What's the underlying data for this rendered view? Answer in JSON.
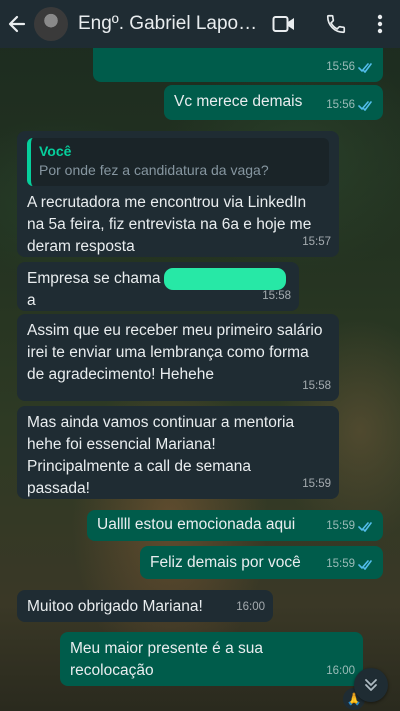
{
  "header": {
    "contact_name": "Engº. Gabriel Laporti..."
  },
  "messages": [
    {
      "id": "m0",
      "text": "",
      "time": "15:56",
      "read": true
    },
    {
      "id": "m1",
      "text": "Vc merece demais",
      "time": "15:56",
      "read": true
    },
    {
      "id": "m2",
      "quote_author": "Você",
      "quote_text": "Por onde fez a candidatura da vaga?",
      "text": "A recrutadora me encontrou via LinkedIn na 5a feira, fiz entrevista na 6a e hoje me deram resposta",
      "time": "15:57"
    },
    {
      "id": "m3",
      "text": "Empresa se chama",
      "text_tail": "a",
      "time": "15:58"
    },
    {
      "id": "m4",
      "text": "Assim que eu receber meu primeiro salário irei te enviar uma lembrança como forma de agradecimento!  Hehehe",
      "time": "15:58"
    },
    {
      "id": "m5",
      "text": "Mas ainda vamos continuar a mentoria hehe foi essencial Mariana! Principalmente a call de semana passada!",
      "time": "15:59"
    },
    {
      "id": "m6",
      "text": "Uallll estou emocionada aqui",
      "time": "15:59",
      "read": true
    },
    {
      "id": "m7",
      "text": "Feliz demais por você",
      "time": "15:59",
      "read": true
    },
    {
      "id": "m8",
      "text": "Muitoo obrigado Mariana!",
      "time": "16:00"
    },
    {
      "id": "m9",
      "text": "Meu maior presente é a sua recolocação",
      "time": "16:00",
      "reaction": "🙏"
    }
  ],
  "colors": {
    "header": "#1f2c33",
    "outgoing_bubble": "#005c4b",
    "incoming_bubble": "#1f2c33",
    "read_ticks": "#53bdeb",
    "quote_accent": "#06cf9c"
  }
}
